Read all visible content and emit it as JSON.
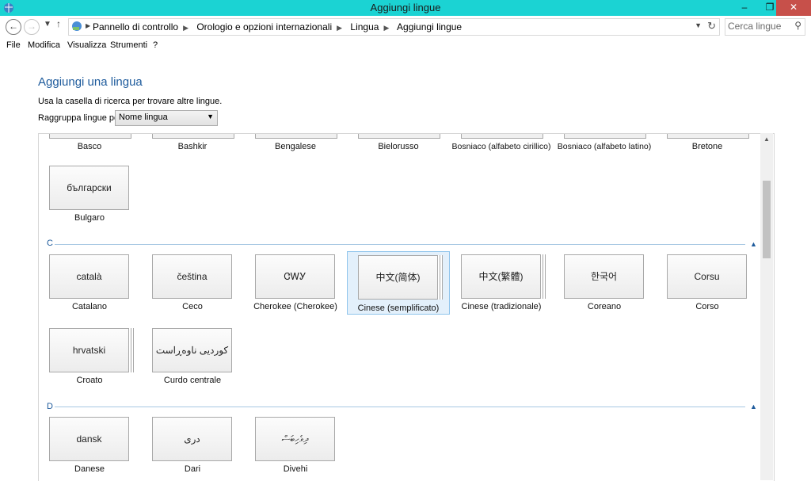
{
  "window": {
    "title": "Aggiungi lingue",
    "controls": [
      "–",
      "❐",
      "✕"
    ]
  },
  "address": {
    "crumbs": [
      "Pannello di controllo",
      "Orologio e opzioni internazionali",
      "Lingua",
      "Aggiungi lingue"
    ]
  },
  "search": {
    "placeholder": "Cerca lingue"
  },
  "menu": [
    "File",
    "Modifica",
    "Visualizza",
    "Strumenti",
    "?"
  ],
  "page": {
    "heading": "Aggiungi una lingua",
    "instructions": "Usa la casella di ricerca per trovare altre lingue.",
    "group_label": "Raggruppa lingue per:",
    "group_value": "Nome lingua"
  },
  "sections": {
    "B": {
      "top_row": [
        "Basco",
        "Bashkir",
        "Bengalese",
        "Bielorusso",
        "Bosniaco (alfabeto cirillico)",
        "Bosniaco (alfabeto latino)",
        "Bretone"
      ],
      "items": [
        {
          "tile": "български",
          "caption": "Bulgaro"
        }
      ]
    },
    "C": {
      "letter": "C",
      "items": [
        {
          "tile": "català",
          "caption": "Catalano"
        },
        {
          "tile": "čeština",
          "caption": "Ceco"
        },
        {
          "tile": "ᏣᎳᎩ",
          "caption": "Cherokee (Cherokee)"
        },
        {
          "tile": "中文(简体)",
          "caption": "Cinese (semplificato)"
        },
        {
          "tile": "中文(繁體)",
          "caption": "Cinese (tradizionale)"
        },
        {
          "tile": "한국어",
          "caption": "Coreano"
        },
        {
          "tile": "Corsu",
          "caption": "Corso"
        },
        {
          "tile": "hrvatski",
          "caption": "Croato"
        },
        {
          "tile": "کوردیی ناوەڕاست",
          "caption": "Curdo centrale"
        }
      ]
    },
    "D": {
      "letter": "D",
      "items": [
        {
          "tile": "dansk",
          "caption": "Danese"
        },
        {
          "tile": "دری",
          "caption": "Dari"
        },
        {
          "tile": "ދިވެހިބަސް",
          "caption": "Divehi"
        }
      ]
    }
  }
}
